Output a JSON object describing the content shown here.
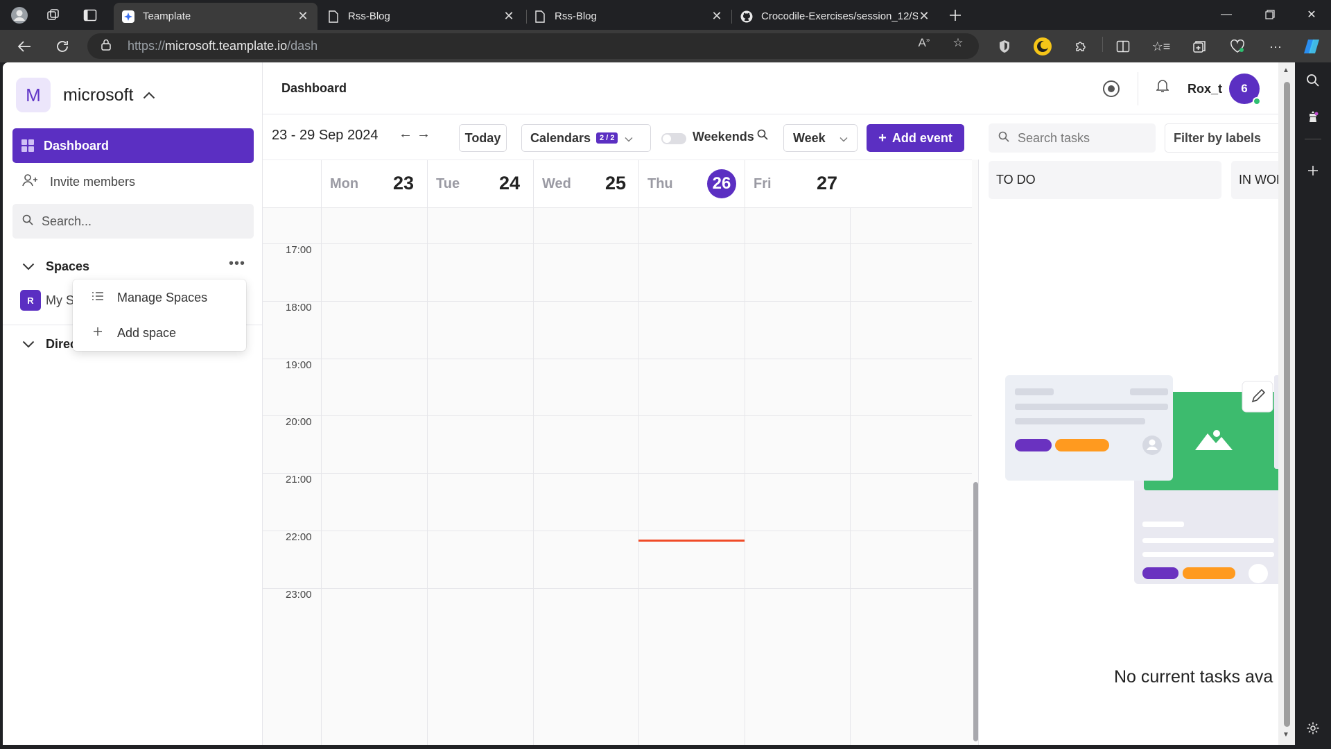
{
  "browser": {
    "tabs": [
      {
        "title": "Teamplate",
        "active": true
      },
      {
        "title": "Rss-Blog",
        "active": false
      },
      {
        "title": "Rss-Blog",
        "active": false
      },
      {
        "title": "Crocodile-Exercises/session_12/S",
        "active": false
      }
    ],
    "url_host": "https://microsoft.teamplate.io",
    "url_path": "/dash",
    "url_scheme_prefix": "https://",
    "url_domain": "microsoft.teamplate.io"
  },
  "workspace": {
    "initial": "M",
    "name": "microsoft"
  },
  "sidebar": {
    "dashboard_label": "Dashboard",
    "invite_label": "Invite members",
    "search_placeholder": "Search...",
    "spaces_label": "Spaces",
    "space_badge": "R",
    "space_name_visible": "My S",
    "direct_label_visible": "Direc"
  },
  "popover": {
    "items": [
      {
        "label": "Manage Spaces",
        "icon": "list-icon"
      },
      {
        "label": "Add space",
        "icon": "plus-icon"
      }
    ]
  },
  "header": {
    "title": "Dashboard",
    "username": "Rox_t",
    "avatar_text": "6"
  },
  "calendar": {
    "range": "23 - 29 Sep 2024",
    "today_label": "Today",
    "calendars_label": "Calendars",
    "calendars_count": "2 / 2",
    "weekends_label": "Weekends",
    "view_label": "Week",
    "add_event_label": "Add event",
    "days": [
      {
        "name": "Mon",
        "num": "23",
        "today": false
      },
      {
        "name": "Tue",
        "num": "24",
        "today": false
      },
      {
        "name": "Wed",
        "num": "25",
        "today": false
      },
      {
        "name": "Thu",
        "num": "26",
        "today": true
      },
      {
        "name": "Fri",
        "num": "27",
        "today": false
      }
    ],
    "times": [
      "17:00",
      "18:00",
      "19:00",
      "20:00",
      "21:00",
      "22:00",
      "23:00"
    ]
  },
  "tasks": {
    "search_placeholder": "Search tasks",
    "filter_label": "Filter by labels",
    "columns": [
      "TO DO",
      "IN WOR"
    ],
    "empty_message": "No current tasks ava"
  },
  "colors": {
    "accent": "#5b2fc2",
    "now_line": "#f04b28",
    "illus_green": "#3dbb6e",
    "illus_orange": "#ff9a1f",
    "illus_purple": "#6a32c0"
  }
}
